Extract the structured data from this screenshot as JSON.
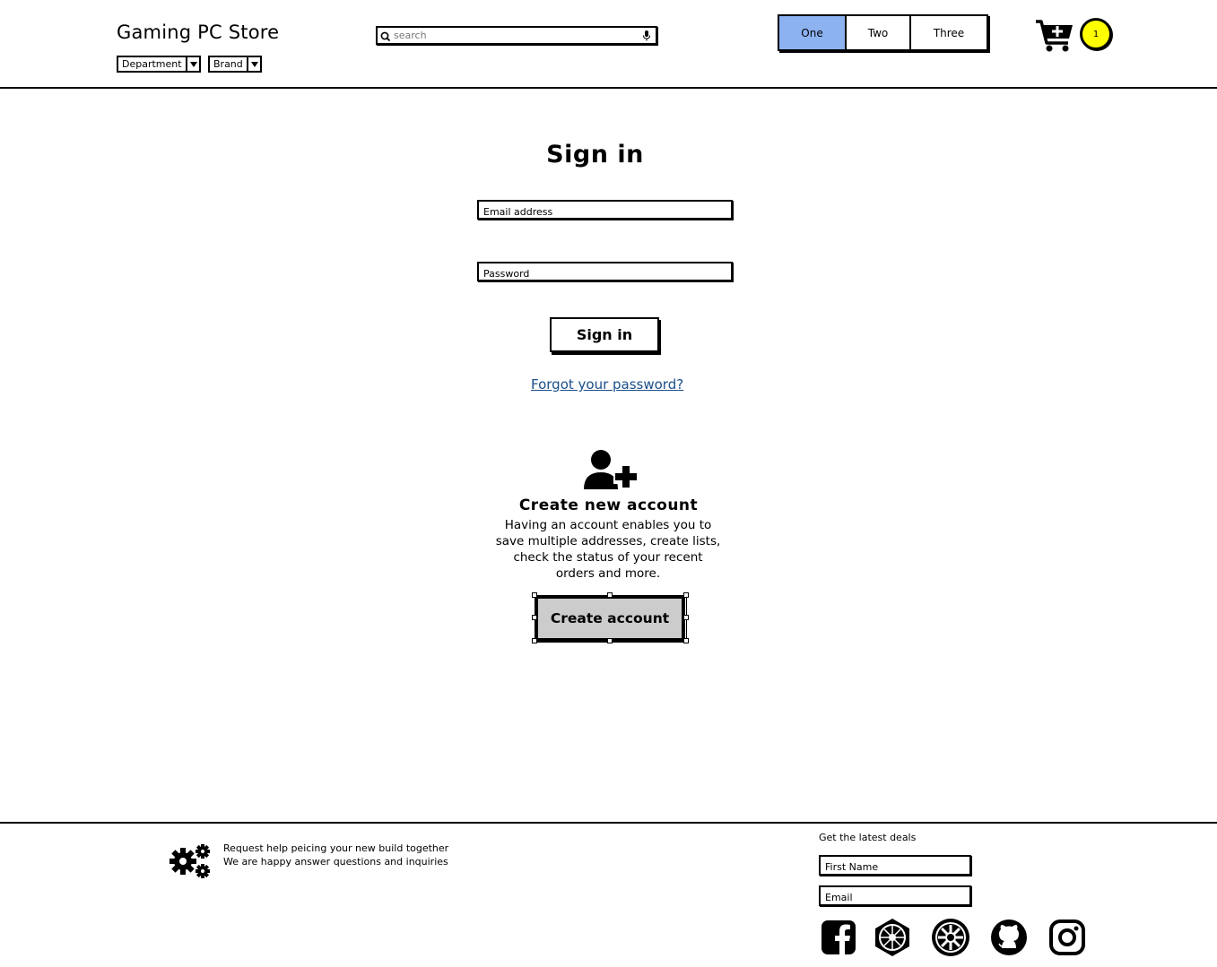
{
  "header": {
    "title": "Gaming PC Store",
    "dropdowns": {
      "department": "Department",
      "brand": "Brand"
    },
    "search": {
      "placeholder": "search"
    },
    "tabs": [
      {
        "label": "One",
        "active": true
      },
      {
        "label": "Two"
      },
      {
        "label": "Three"
      }
    ],
    "cart": {
      "icon": "cart-plus-icon",
      "badge": "1",
      "badge_color": "#ffff00"
    }
  },
  "main": {
    "signin_title": "Sign in",
    "email_placeholder": "Email address",
    "password_placeholder": "Password",
    "signin_button": "Sign in",
    "forgot_link": "Forgot your password?",
    "create_icon": "user-plus-icon",
    "create_title": "Create new account",
    "create_desc_lines": [
      "Having an account enables you to",
      "save multiple addresses, create lists,",
      "check the status of your recent",
      "orders and more."
    ],
    "create_button": "Create account"
  },
  "footer": {
    "help_lines": [
      "Request help peicing your new build together",
      "We are happy answer questions and inquiries"
    ],
    "deals_title": "Get the latest deals",
    "first_name_placeholder": "First Name",
    "email_placeholder": "Email",
    "social": [
      "facebook-icon",
      "first-order-icon",
      "galactic-republic-icon",
      "github-icon",
      "instagram-icon"
    ]
  },
  "colors": {
    "active_tab": "#8cb2f0",
    "link": "#1a4f8a",
    "create_button_bg": "#cccccc"
  }
}
